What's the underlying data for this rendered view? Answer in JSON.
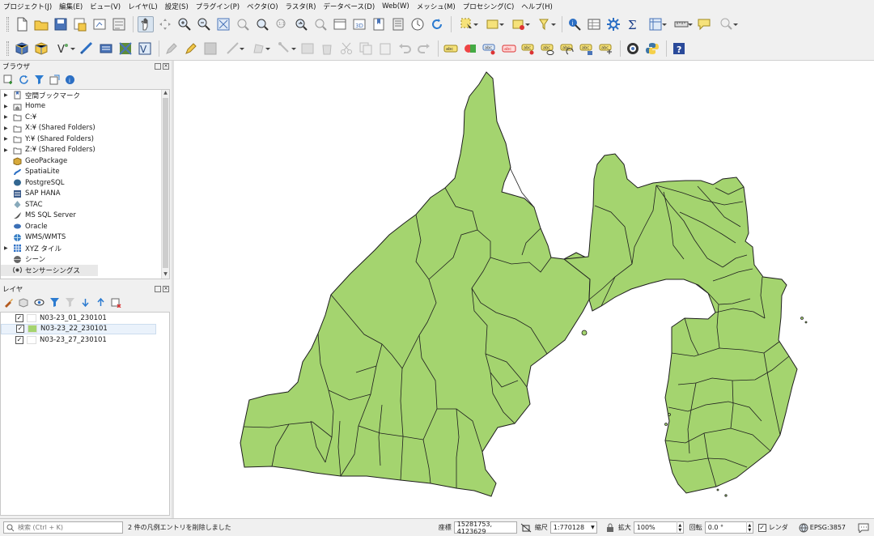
{
  "menu": [
    "プロジェクト(J)",
    "編集(E)",
    "ビュー(V)",
    "レイヤ(L)",
    "設定(S)",
    "プラグイン(P)",
    "ベクタ(O)",
    "ラスタ(R)",
    "データベース(D)",
    "Web(W)",
    "メッシュ(M)",
    "プロセシング(C)",
    "ヘルプ(H)"
  ],
  "browser": {
    "title": "ブラウザ",
    "items": [
      {
        "label": "空間ブックマーク",
        "icon": "bookmark-icon",
        "expandable": true
      },
      {
        "label": "Home",
        "icon": "home-folder-icon",
        "expandable": true
      },
      {
        "label": "C:¥",
        "icon": "folder-icon",
        "expandable": true
      },
      {
        "label": "X:¥ (Shared Folders)",
        "icon": "folder-icon",
        "expandable": true
      },
      {
        "label": "Y:¥ (Shared Folders)",
        "icon": "folder-icon",
        "expandable": true
      },
      {
        "label": "Z:¥ (Shared Folders)",
        "icon": "folder-icon",
        "expandable": true
      },
      {
        "label": "GeoPackage",
        "icon": "geopackage-icon",
        "expandable": false
      },
      {
        "label": "SpatiaLite",
        "icon": "spatialite-icon",
        "expandable": false
      },
      {
        "label": "PostgreSQL",
        "icon": "postgresql-icon",
        "expandable": false
      },
      {
        "label": "SAP HANA",
        "icon": "sap-hana-icon",
        "expandable": false
      },
      {
        "label": "STAC",
        "icon": "stac-icon",
        "expandable": false
      },
      {
        "label": "MS SQL Server",
        "icon": "mssql-icon",
        "expandable": false
      },
      {
        "label": "Oracle",
        "icon": "oracle-icon",
        "expandable": false
      },
      {
        "label": "WMS/WMTS",
        "icon": "wms-icon",
        "expandable": false
      },
      {
        "label": "XYZ タイル",
        "icon": "xyz-tiles-icon",
        "expandable": true
      },
      {
        "label": "シーン",
        "icon": "scene-icon",
        "expandable": false
      },
      {
        "label": "センサーシングス",
        "icon": "sensorthings-icon",
        "expandable": false
      }
    ]
  },
  "layers": {
    "title": "レイヤ",
    "items": [
      {
        "label": "N03-23_01_230101",
        "checked": true,
        "swatch": "#ffffff"
      },
      {
        "label": "N03-23_22_230101",
        "checked": true,
        "swatch": "#a4d46f"
      },
      {
        "label": "N03-23_27_230101",
        "checked": true,
        "swatch": "#ffffff"
      }
    ]
  },
  "map": {
    "fill": "#a4d46f",
    "stroke": "#1e1e1e"
  },
  "status": {
    "search_placeholder": "検索 (Ctrl + K)",
    "message": "2 件の凡例エントリを削除しました",
    "coord_label": "座標",
    "coord_value": "15281753, 4123629",
    "scale_label": "縮尺",
    "scale_value": "1:770128",
    "magnify_label": "拡大",
    "magnify_value": "100%",
    "rotation_label": "回転",
    "rotation_value": "0.0 °",
    "render_label": "レンダ",
    "crs": "EPSG:3857"
  }
}
